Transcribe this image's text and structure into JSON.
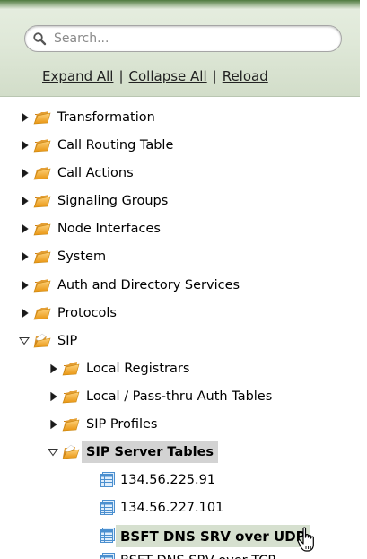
{
  "search": {
    "placeholder": "Search..."
  },
  "links": {
    "expand": "Expand All",
    "separator": "|",
    "collapse": "Collapse All",
    "reload": "Reload"
  },
  "tree": {
    "transformation": "Transformation",
    "call_routing_table": "Call Routing Table",
    "call_actions": "Call Actions",
    "signaling_groups": "Signaling Groups",
    "node_interfaces": "Node Interfaces",
    "system": "System",
    "auth_directory": "Auth and Directory Services",
    "protocols": "Protocols",
    "sip": "SIP",
    "local_registrars": "Local Registrars",
    "local_pass_thru": "Local / Pass-thru Auth Tables",
    "sip_profiles": "SIP Profiles",
    "sip_server_tables": "SIP Server Tables",
    "server_1": "134.56.225.91",
    "server_2": "134.56.227.101",
    "server_3": "BSFT DNS SRV over UDP",
    "server_4": "BSFT DNS SRV over TCP"
  },
  "colors": {
    "header_bg": "#dfe8d8",
    "selected_bg": "#d3d3d3",
    "hover_bg": "#d6e0cf",
    "folder": "#f0a72a"
  }
}
